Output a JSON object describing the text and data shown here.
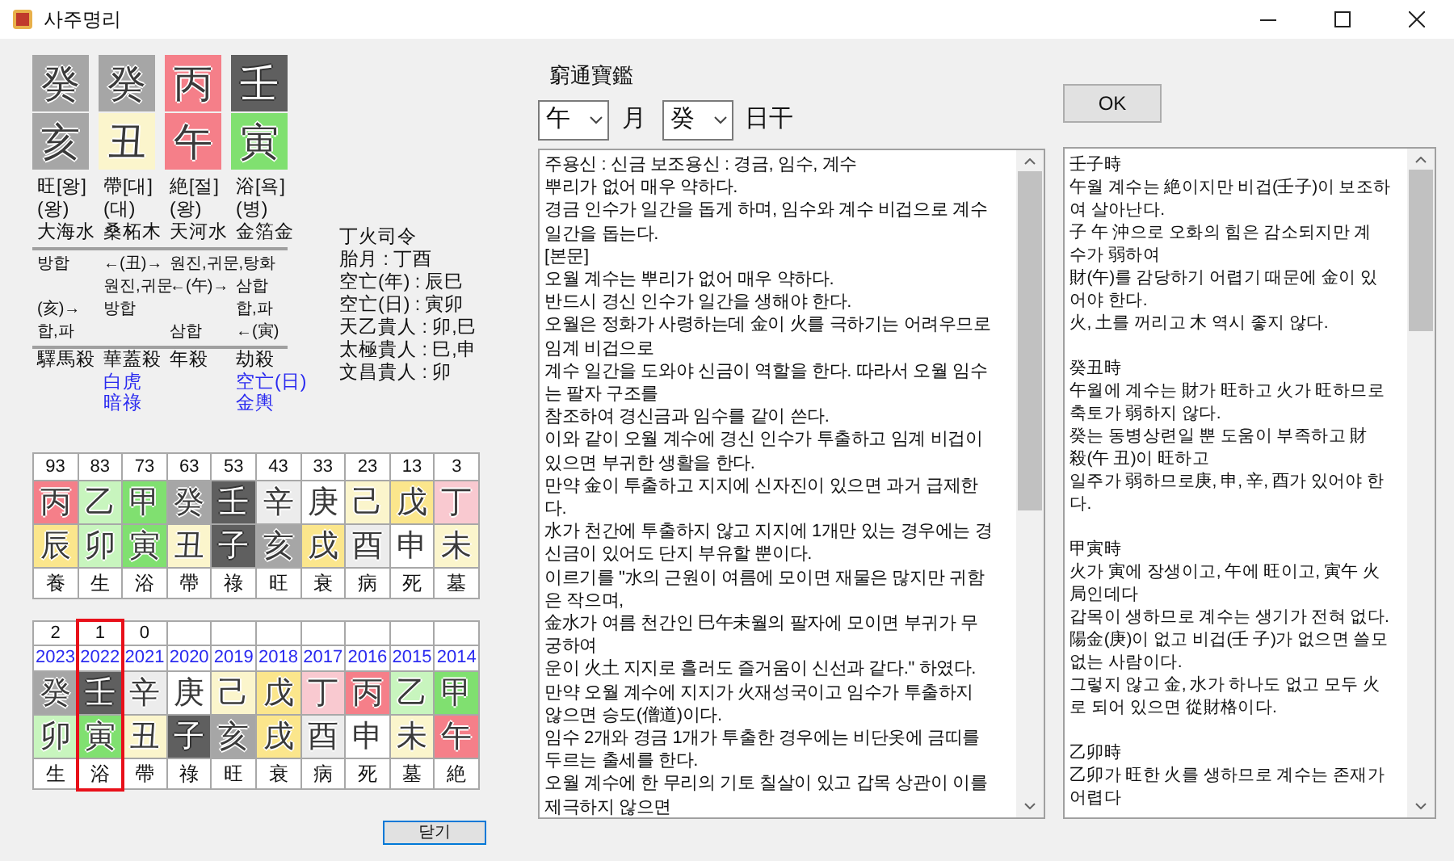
{
  "window": {
    "title": "사주명리"
  },
  "pillars": [
    {
      "stem": {
        "char": "癸",
        "color": "#a6a6a6"
      },
      "branch": {
        "char": "亥",
        "color": "#a6a6a6"
      },
      "stage": "旺[왕]",
      "stage_note": "(왕)",
      "napeum": "大海水",
      "sals": [
        {
          "text": "驛馬殺",
          "kind": "main"
        }
      ]
    },
    {
      "stem": {
        "char": "癸",
        "color": "#a6a6a6"
      },
      "branch": {
        "char": "丑",
        "color": "#fbf5cc"
      },
      "stage": "帶[대]",
      "stage_note": "(대)",
      "napeum": "桑柘木",
      "sals": [
        {
          "text": "華蓋殺",
          "kind": "main"
        },
        {
          "text": "白虎",
          "kind": "extra"
        },
        {
          "text": "暗祿",
          "kind": "extra"
        }
      ]
    },
    {
      "stem": {
        "char": "丙",
        "color": "#f57f89"
      },
      "branch": {
        "char": "午",
        "color": "#f57f89"
      },
      "stage": "絶[절]",
      "stage_note": "(왕)",
      "napeum": "天河水",
      "sals": [
        {
          "text": "年殺",
          "kind": "main"
        }
      ]
    },
    {
      "stem": {
        "char": "壬",
        "color": "#5f5f5f"
      },
      "branch": {
        "char": "寅",
        "color": "#80e070"
      },
      "stage": "浴[욕]",
      "stage_note": "(병)",
      "napeum": "金箔金",
      "sals": [
        {
          "text": "劫殺",
          "kind": "main"
        },
        {
          "text": "空亡(日)",
          "kind": "extra"
        },
        {
          "text": "金輿",
          "kind": "extra"
        }
      ]
    }
  ],
  "relations": [
    {
      "column_1": "방합",
      "column_2": "←(丑)→",
      "column_3": "원진,귀문,탕화"
    },
    {
      "column_2": "원진,귀문",
      "column_3": "←(午)→",
      "column_4": "삼합"
    },
    {
      "column_1": "(亥)→",
      "column_2": "방합",
      "column_4": "합,파"
    },
    {
      "column_1": "합,파",
      "column_3": "삼합",
      "column_4": "←(寅)"
    }
  ],
  "info": [
    "丁火司令",
    "胎月 : 丁酉",
    "空亡(年) : 辰巳",
    "空亡(日) : 寅卯",
    "天乙貴人 : 卯,巳",
    "太極貴人 : 巳,申",
    "文昌貴人 : 卯"
  ],
  "daeun": [
    {
      "age": "93",
      "stem": {
        "char": "丙",
        "color": "#f57f89"
      },
      "branch": {
        "char": "辰",
        "color": "#fbe68c"
      },
      "stage": "養"
    },
    {
      "age": "83",
      "stem": {
        "char": "乙",
        "color": "#c8f5be"
      },
      "branch": {
        "char": "卯",
        "color": "#c8f5be"
      },
      "stage": "生"
    },
    {
      "age": "73",
      "stem": {
        "char": "甲",
        "color": "#80e070"
      },
      "branch": {
        "char": "寅",
        "color": "#80e070"
      },
      "stage": "浴"
    },
    {
      "age": "63",
      "stem": {
        "char": "癸",
        "color": "#a6a6a6"
      },
      "branch": {
        "char": "丑",
        "color": "#fbf5cc"
      },
      "stage": "帶"
    },
    {
      "age": "53",
      "stem": {
        "char": "壬",
        "color": "#5f5f5f"
      },
      "branch": {
        "char": "子",
        "color": "#5f5f5f"
      },
      "stage": "祿"
    },
    {
      "age": "43",
      "stem": {
        "char": "辛",
        "color": "#ececec"
      },
      "branch": {
        "char": "亥",
        "color": "#a6a6a6"
      },
      "stage": "旺"
    },
    {
      "age": "33",
      "stem": {
        "char": "庚",
        "color": "#ffffff"
      },
      "branch": {
        "char": "戌",
        "color": "#fbe68c"
      },
      "stage": "衰"
    },
    {
      "age": "23",
      "stem": {
        "char": "己",
        "color": "#fbf5cc"
      },
      "branch": {
        "char": "酉",
        "color": "#ececec"
      },
      "stage": "病"
    },
    {
      "age": "13",
      "stem": {
        "char": "戊",
        "color": "#fbe68c"
      },
      "branch": {
        "char": "申",
        "color": "#ffffff"
      },
      "stage": "死"
    },
    {
      "age": "3",
      "stem": {
        "char": "丁",
        "color": "#f9c9d0"
      },
      "branch": {
        "char": "未",
        "color": "#fbf5cc"
      },
      "stage": "墓"
    }
  ],
  "years": [
    {
      "age": "2",
      "year": "2023",
      "stem": {
        "char": "癸",
        "color": "#a6a6a6"
      },
      "branch": {
        "char": "卯",
        "color": "#c8f5be"
      },
      "stage": "生",
      "selected": false
    },
    {
      "age": "1",
      "year": "2022",
      "stem": {
        "char": "壬",
        "color": "#5f5f5f"
      },
      "branch": {
        "char": "寅",
        "color": "#80e070"
      },
      "stage": "浴",
      "selected": true
    },
    {
      "age": "0",
      "year": "2021",
      "stem": {
        "char": "辛",
        "color": "#ececec"
      },
      "branch": {
        "char": "丑",
        "color": "#fbf5cc"
      },
      "stage": "帶",
      "selected": false
    },
    {
      "year": "2020",
      "stem": {
        "char": "庚",
        "color": "#ffffff"
      },
      "branch": {
        "char": "子",
        "color": "#5f5f5f"
      },
      "stage": "祿",
      "selected": false
    },
    {
      "year": "2019",
      "stem": {
        "char": "己",
        "color": "#fbf5cc"
      },
      "branch": {
        "char": "亥",
        "color": "#a6a6a6"
      },
      "stage": "旺",
      "selected": false
    },
    {
      "year": "2018",
      "stem": {
        "char": "戊",
        "color": "#fbe68c"
      },
      "branch": {
        "char": "戌",
        "color": "#fbe68c"
      },
      "stage": "衰",
      "selected": false
    },
    {
      "year": "2017",
      "stem": {
        "char": "丁",
        "color": "#f9c9d0"
      },
      "branch": {
        "char": "酉",
        "color": "#ececec"
      },
      "stage": "病",
      "selected": false
    },
    {
      "year": "2016",
      "stem": {
        "char": "丙",
        "color": "#f57f89"
      },
      "branch": {
        "char": "申",
        "color": "#ffffff"
      },
      "stage": "死",
      "selected": false
    },
    {
      "year": "2015",
      "stem": {
        "char": "乙",
        "color": "#c8f5be"
      },
      "branch": {
        "char": "未",
        "color": "#fbf5cc"
      },
      "stage": "墓",
      "selected": false
    },
    {
      "year": "2014",
      "stem": {
        "char": "甲",
        "color": "#80e070"
      },
      "branch": {
        "char": "午",
        "color": "#f57f89"
      },
      "stage": "絶",
      "selected": false
    }
  ],
  "close_button": "닫기",
  "book_title": "窮通寶鑑",
  "month_select": {
    "value": "午"
  },
  "month_label": "月",
  "day_select": {
    "value": "癸"
  },
  "day_label": "日干",
  "ok_button": "OK",
  "main_text": [
    "주용신 : 신금 보조용신 : 경금, 임수, 계수",
    "뿌리가 없어 매우 약하다.",
    "경금 인수가 일간을 돕게 하며, 임수와 계수 비겁으로 계수",
    "일간을 돕는다.",
    "[본문]",
    "오월 계수는 뿌리가 없어 매우 약하다.",
    "반드시 경신 인수가 일간을 생해야 한다.",
    "오월은 정화가 사령하는데 金이 火를 극하기는 어려우므로",
    "임계 비겁으로",
    "계수 일간을 도와야 신금이 역할을 한다. 따라서 오월 임수",
    "는 팔자 구조를",
    "참조하여 경신금과 임수를 같이 쓴다.",
    "이와 같이 오월 계수에 경신 인수가 투출하고 임계 비겁이",
    "있으면 부귀한 생활을 한다.",
    "만약 金이 투출하고 지지에 신자진이 있으면 과거 급제한",
    "다.",
    "水가 천간에 투출하지 않고 지지에 1개만 있는 경우에는 경",
    "신금이 있어도 단지 부유할 뿐이다.",
    "이르기를 \"水의 근원이 여름에 모이면 재물은 많지만 귀함",
    "은 작으며,",
    "金水가 여름 천간인 巳午未월의 팔자에 모이면 부귀가 무",
    "궁하여",
    "운이 火土 지지로 흘러도 즐거움이 신선과 같다.\" 하였다.",
    "만약 오월 계수에 지지가 火재성국이고 임수가 투출하지",
    "않으면 승도(僧道)이다.",
    "임수 2개와 경금 1개가 투출한 경우에는 비단옷에 금띠를",
    "두르는 출세를 한다.",
    "오월 계수에 한 무리의 기토 칠살이 있고 갑목 상관이 이를",
    "제극하지 않으면"
  ],
  "hour_sections": [
    {
      "lines": [
        "壬子時",
        "午월 계수는 絶이지만 비겁(壬子)이 보조하",
        "여 살아난다.",
        "子 午 沖으로 오화의 힘은 감소되지만 계",
        "수가 弱하여",
        "財(午)를 감당하기 어렵기 때문에 金이 있",
        "어야 한다.",
        "火, 土를 꺼리고 木 역시 좋지 않다."
      ]
    },
    {
      "lines": [
        "癸丑時",
        "午월에 계수는 財가 旺하고 火가 旺하므로",
        "축토가 弱하지 않다.",
        "癸는 동병상련일 뿐 도움이 부족하고 財",
        "殺(午 丑)이 旺하고",
        "일주가 弱하므로庚, 申, 辛, 酉가 있어야 한",
        "다."
      ]
    },
    {
      "lines": [
        "甲寅時",
        "火가 寅에 장생이고, 午에 旺이고, 寅午 火",
        "局인데다",
        "갑목이 생하므로 계수는 생기가 전혀 없다.",
        "陽金(庚)이 없고 비겁(壬 子)가 없으면 쓸모",
        "없는 사람이다.",
        "그렇지 않고 金, 水가 하나도 없고 모두 火",
        "로 되어 있으면 從財格이다."
      ]
    },
    {
      "lines": [
        "乙卯時",
        "乙卯가 旺한 火를 생하므로 계수는 존재가",
        "어렵다"
      ]
    }
  ]
}
